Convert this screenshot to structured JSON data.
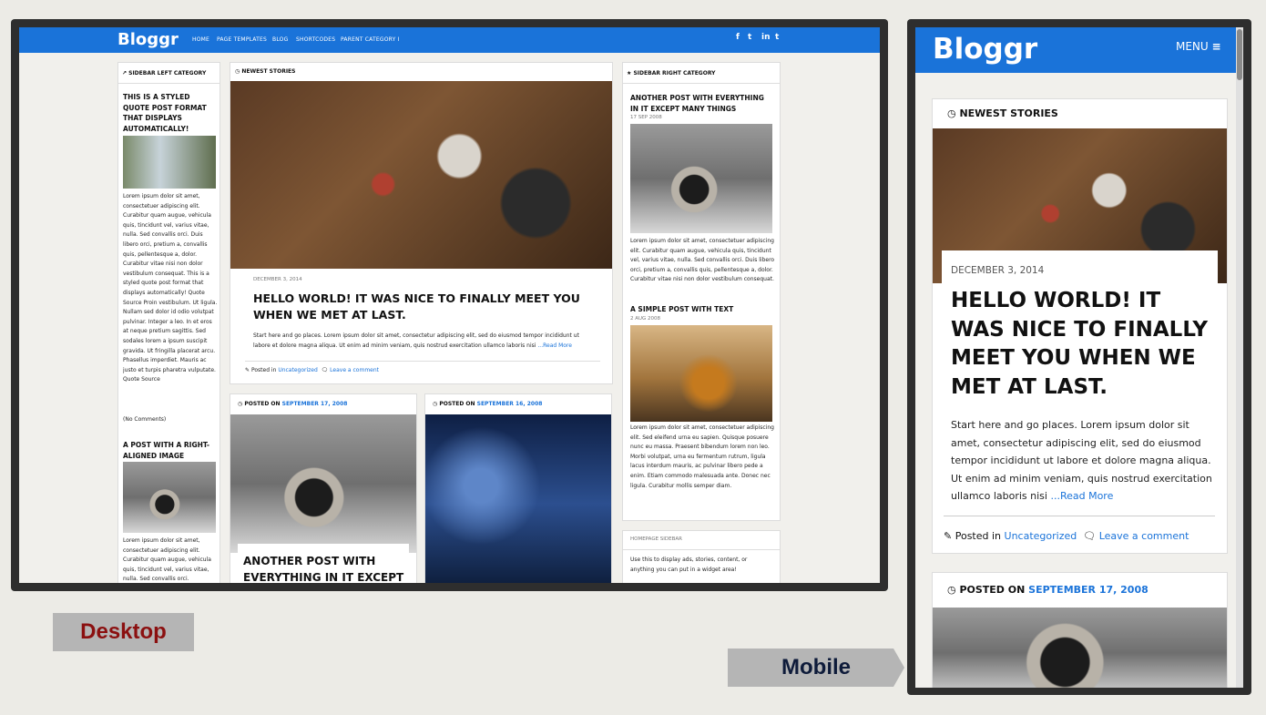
{
  "desktop": {
    "logo": "Bloggr",
    "nav": [
      "HOME",
      "PAGE TEMPLATES",
      "BLOG",
      "SHORTCODES",
      "PARENT CATEGORY I"
    ],
    "social": [
      "f",
      "t",
      "in",
      "t"
    ],
    "left_sidebar": {
      "title": "SIDEBAR LEFT CATEGORY",
      "post1_title": "THIS IS A STYLED QUOTE POST FORMAT THAT DISPLAYS AUTOMATICALLY!",
      "post1_text": "Lorem ipsum dolor sit amet, consectetuer adipiscing elit. Curabitur quam augue, vehicula quis, tincidunt vel, varius vitae, nulla. Sed convallis orci. Duis libero orci, pretium a, convallis quis, pellentesque a, dolor. Curabitur vitae nisi non dolor vestibulum consequat. This is a styled quote post format that displays automatically! Quote Source Proin vestibulum. Ut ligula. Nullam sed dolor id odio volutpat pulvinar. Integer a leo. In et eros at neque pretium sagittis. Sed sodales lorem a ipsum suscipit gravida. Ut fringilla placerat arcu. Phasellus imperdiet. Mauris ac justo et turpis pharetra vulputate. Quote Source",
      "no_comments": "(No Comments)",
      "post2_title": "A POST WITH A RIGHT-ALIGNED IMAGE",
      "post2_text": "Lorem ipsum dolor sit amet, consectetuer adipiscing elit. Curabitur quam augue, vehicula quis, tincidunt vel, varius vitae, nulla. Sed convallis orci."
    },
    "featured": {
      "section": "NEWEST STORIES",
      "date": "DECEMBER 3, 2014",
      "title": "HELLO WORLD! IT WAS NICE TO FINALLY MEET YOU WHEN WE MET AT LAST.",
      "excerpt": "Start here and go places. Lorem ipsum dolor sit amet, consectetur adipiscing elit, sed do eiusmod tempor incididunt ut labore et dolore magna aliqua. Ut enim ad minim veniam, quis nostrud exercitation ullamco laboris nisi",
      "read_more": "...Read More",
      "posted_in": "Posted in",
      "category": "Uncategorized",
      "leave_comment": "Leave a comment"
    },
    "grid": {
      "left_posted_on": "POSTED ON",
      "left_date": "SEPTEMBER 17, 2008",
      "left_title": "ANOTHER POST WITH EVERYTHING IN IT EXCEPT",
      "right_posted_on": "POSTED ON",
      "right_date": "SEPTEMBER 16, 2008"
    },
    "right_sidebar": {
      "title": "SIDEBAR RIGHT CATEGORY",
      "post1_title": "ANOTHER POST WITH EVERYTHING IN IT EXCEPT MANY THINGS",
      "post1_date": "17 SEP 2008",
      "post1_text": "Lorem ipsum dolor sit amet, consectetuer adipiscing elit. Curabitur quam augue, vehicula quis, tincidunt vel, varius vitae, nulla. Sed convallis orci. Duis libero orci, pretium a, convallis quis, pellentesque a, dolor. Curabitur vitae nisi non dolor vestibulum consequat.",
      "post2_title": "A SIMPLE POST WITH TEXT",
      "post2_date": "2 AUG 2008",
      "post2_text": "Lorem ipsum dolor sit amet, consectetuer adipiscing elit. Sed eleifend urna eu sapien. Quisque posuere nunc eu massa. Praesent bibendum lorem non leo. Morbi volutpat, urna eu fermentum rutrum, ligula lacus interdum mauris, ac pulvinar libero pede a enim. Etiam commodo malesuada ante. Donec nec ligula. Curabitur mollis semper diam.",
      "homepage_title": "HOMEPAGE SIDEBAR",
      "homepage_text": "Use this to display ads, stories, content, or anything you can put in a widget area!"
    }
  },
  "mobile": {
    "logo": "Bloggr",
    "menu": "MENU",
    "section": "NEWEST STORIES",
    "date": "DECEMBER 3, 2014",
    "title": "HELLO WORLD! IT WAS NICE TO FINALLY MEET YOU WHEN WE MET AT LAST.",
    "excerpt": "Start here and go places. Lorem ipsum dolor sit amet, consectetur adipiscing elit, sed do eiusmod tempor incididunt ut labore et dolore magna aliqua. Ut enim ad minim veniam, quis nostrud exercitation ullamco laboris nisi",
    "read_more": "...Read More",
    "posted_in": "Posted in",
    "category": "Uncategorized",
    "leave_comment": "Leave a comment",
    "posted_on": "POSTED ON",
    "second_date": "SEPTEMBER 17, 2008"
  },
  "labels": {
    "desktop": "Desktop",
    "mobile": "Mobile"
  },
  "colors": {
    "accent": "#1a73d9",
    "frame": "#2e2e2e",
    "desktop_label": "#8b1010",
    "mobile_label": "#0e1b3a"
  }
}
